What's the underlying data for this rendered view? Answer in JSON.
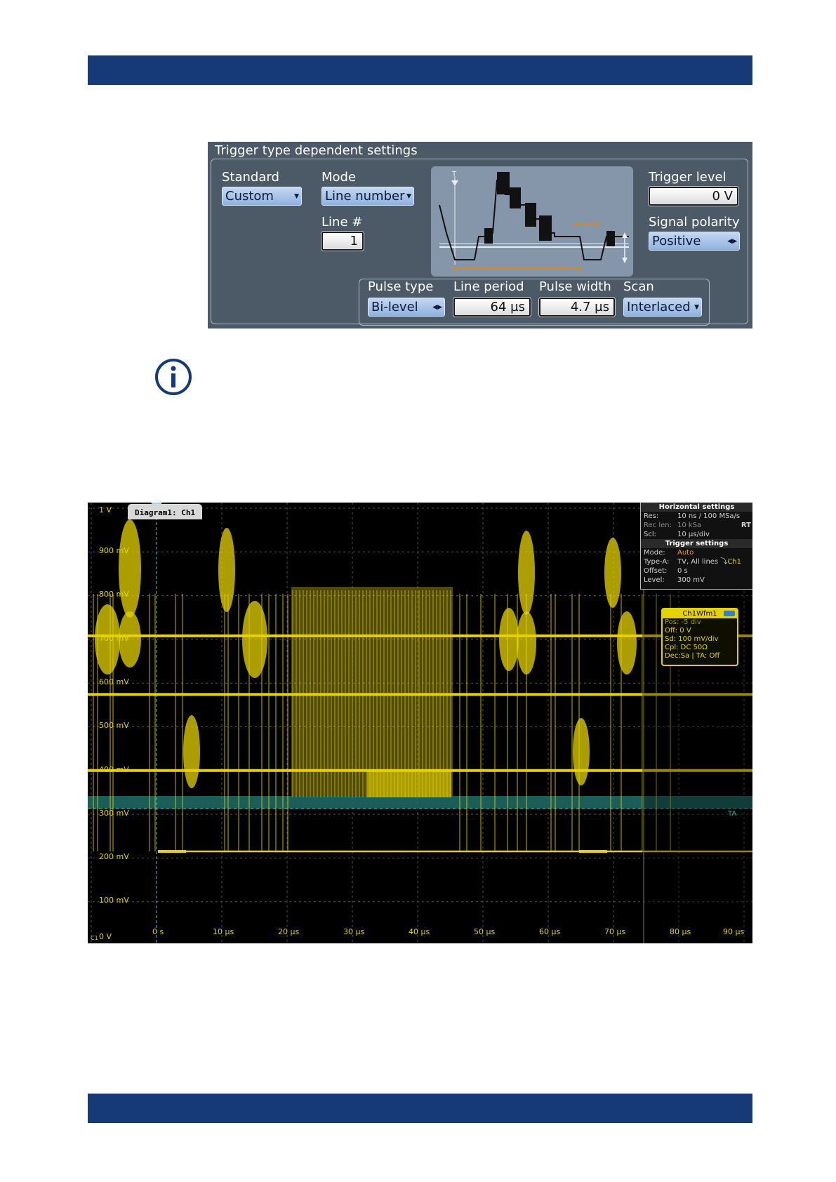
{
  "panel": {
    "title": "Trigger type dependent settings",
    "standard": {
      "label": "Standard",
      "value": "Custom"
    },
    "mode": {
      "label": "Mode",
      "value": "Line number"
    },
    "line": {
      "label": "Line #",
      "value": "1"
    },
    "trigger_level": {
      "label": "Trigger level",
      "value": "0 V"
    },
    "signal_polarity": {
      "label": "Signal polarity",
      "value": "Positive"
    },
    "pulse_type": {
      "label": "Pulse type",
      "value": "Bi-level"
    },
    "line_period": {
      "label": "Line period",
      "value": "64 µs"
    },
    "pulse_width": {
      "label": "Pulse width",
      "value": "4.7 µs"
    },
    "scan": {
      "label": "Scan",
      "value": "Interlaced"
    }
  },
  "scope": {
    "diagram_tab": "Diagram1: Ch1",
    "y_labels": [
      "1 V",
      "900 mV",
      "800 mV",
      "700 mV",
      "600 mV",
      "500 mV",
      "400 mV",
      "300 mV",
      "200 mV",
      "100 mV",
      "0 V"
    ],
    "x_labels": [
      "0 s",
      "10 µs",
      "20 µs",
      "30 µs",
      "40 µs",
      "50 µs",
      "60 µs",
      "70 µs",
      "80 µs",
      "90 µs"
    ],
    "horizontal": {
      "header": "Horizontal settings",
      "res_key": "Res:",
      "res": "10 ns / 100 MSa/s",
      "reclen_key": "Rec len:",
      "reclen": "10 kSa",
      "rt": "RT",
      "scl_key": "Scl:",
      "scl": "10 µs/div"
    },
    "trigger": {
      "header": "Trigger settings",
      "mode_key": "Mode:",
      "mode": "Auto",
      "type_key": "Type-A:",
      "type": "TV, All lines",
      "source": "Ch1",
      "offset_key": "Offset:",
      "offset": "0 s",
      "level_key": "Level:",
      "level": "300 mV"
    },
    "wfm": {
      "header": "Ch1Wfm1",
      "pos": "Pos: -5 div",
      "off": "Off: 0 V",
      "sd": "Sd: 100 mV/div",
      "cpl": "Cpl: DC 50Ω",
      "dec": "Dec:Sa | TA: Off"
    },
    "ta_marker": "TA",
    "c1_marker": "C1",
    "colors": {
      "trace": "#e6d200",
      "trigger_band": "#1e6f6a",
      "grid": "#555555"
    }
  }
}
